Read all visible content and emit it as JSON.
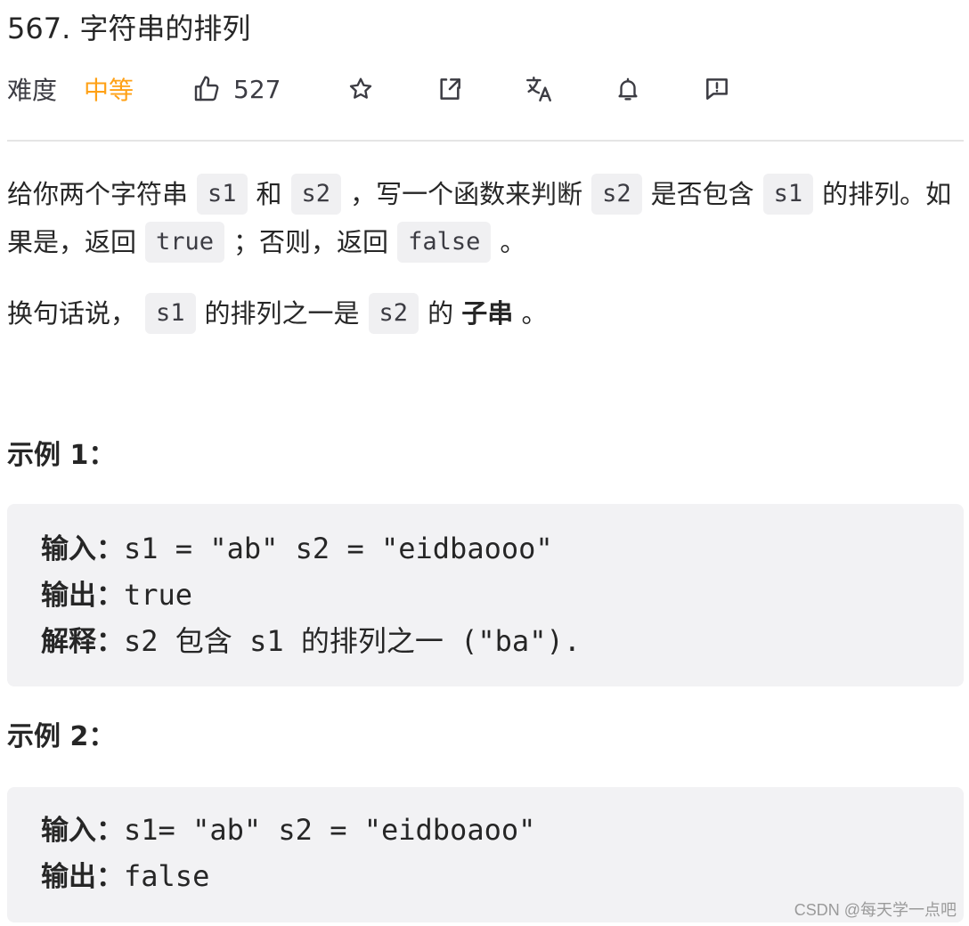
{
  "problem": {
    "title": "567. 字符串的排列",
    "difficulty_label": "难度",
    "difficulty_value": "中等",
    "likes": "527"
  },
  "icons": {
    "like": "thumbs-up-icon",
    "star": "star-icon",
    "share": "share-icon",
    "translate": "translate-icon",
    "notify": "bell-icon",
    "feedback": "feedback-icon"
  },
  "colors": {
    "difficulty": "#ffa116",
    "code_bg": "#f0f0f2",
    "example_bg": "#f2f2f4"
  },
  "description": {
    "p1": {
      "t1": "给你两个字符串",
      "c1": "s1",
      "t2": "和",
      "c2": "s2",
      "t3": "，写一个函数来判断",
      "c3": "s2",
      "t4": "是否包含",
      "c4": "s1",
      "t5": "的排列。如果是，返回",
      "c5": "true",
      "t6": "；否则，返回",
      "c6": "false",
      "t7": "。"
    },
    "p2": {
      "t1": "换句话说，",
      "c1": "s1",
      "t2": "的排列之一是",
      "c2": "s2",
      "t3": "的",
      "strong": "子串",
      "t4": "。"
    }
  },
  "examples": [
    {
      "title": "示例 1：",
      "input_label": "输入：",
      "input_value": "s1 = \"ab\" s2 = \"eidbaooo\"",
      "output_label": "输出：",
      "output_value": "true",
      "explain_label": "解释：",
      "explain_value": "s2 包含 s1 的排列之一 (\"ba\")."
    },
    {
      "title": "示例 2：",
      "input_label": "输入：",
      "input_value": "s1= \"ab\" s2 = \"eidboaoo\"",
      "output_label": "输出：",
      "output_value": "false"
    }
  ],
  "watermark": "CSDN @每天学一点吧"
}
